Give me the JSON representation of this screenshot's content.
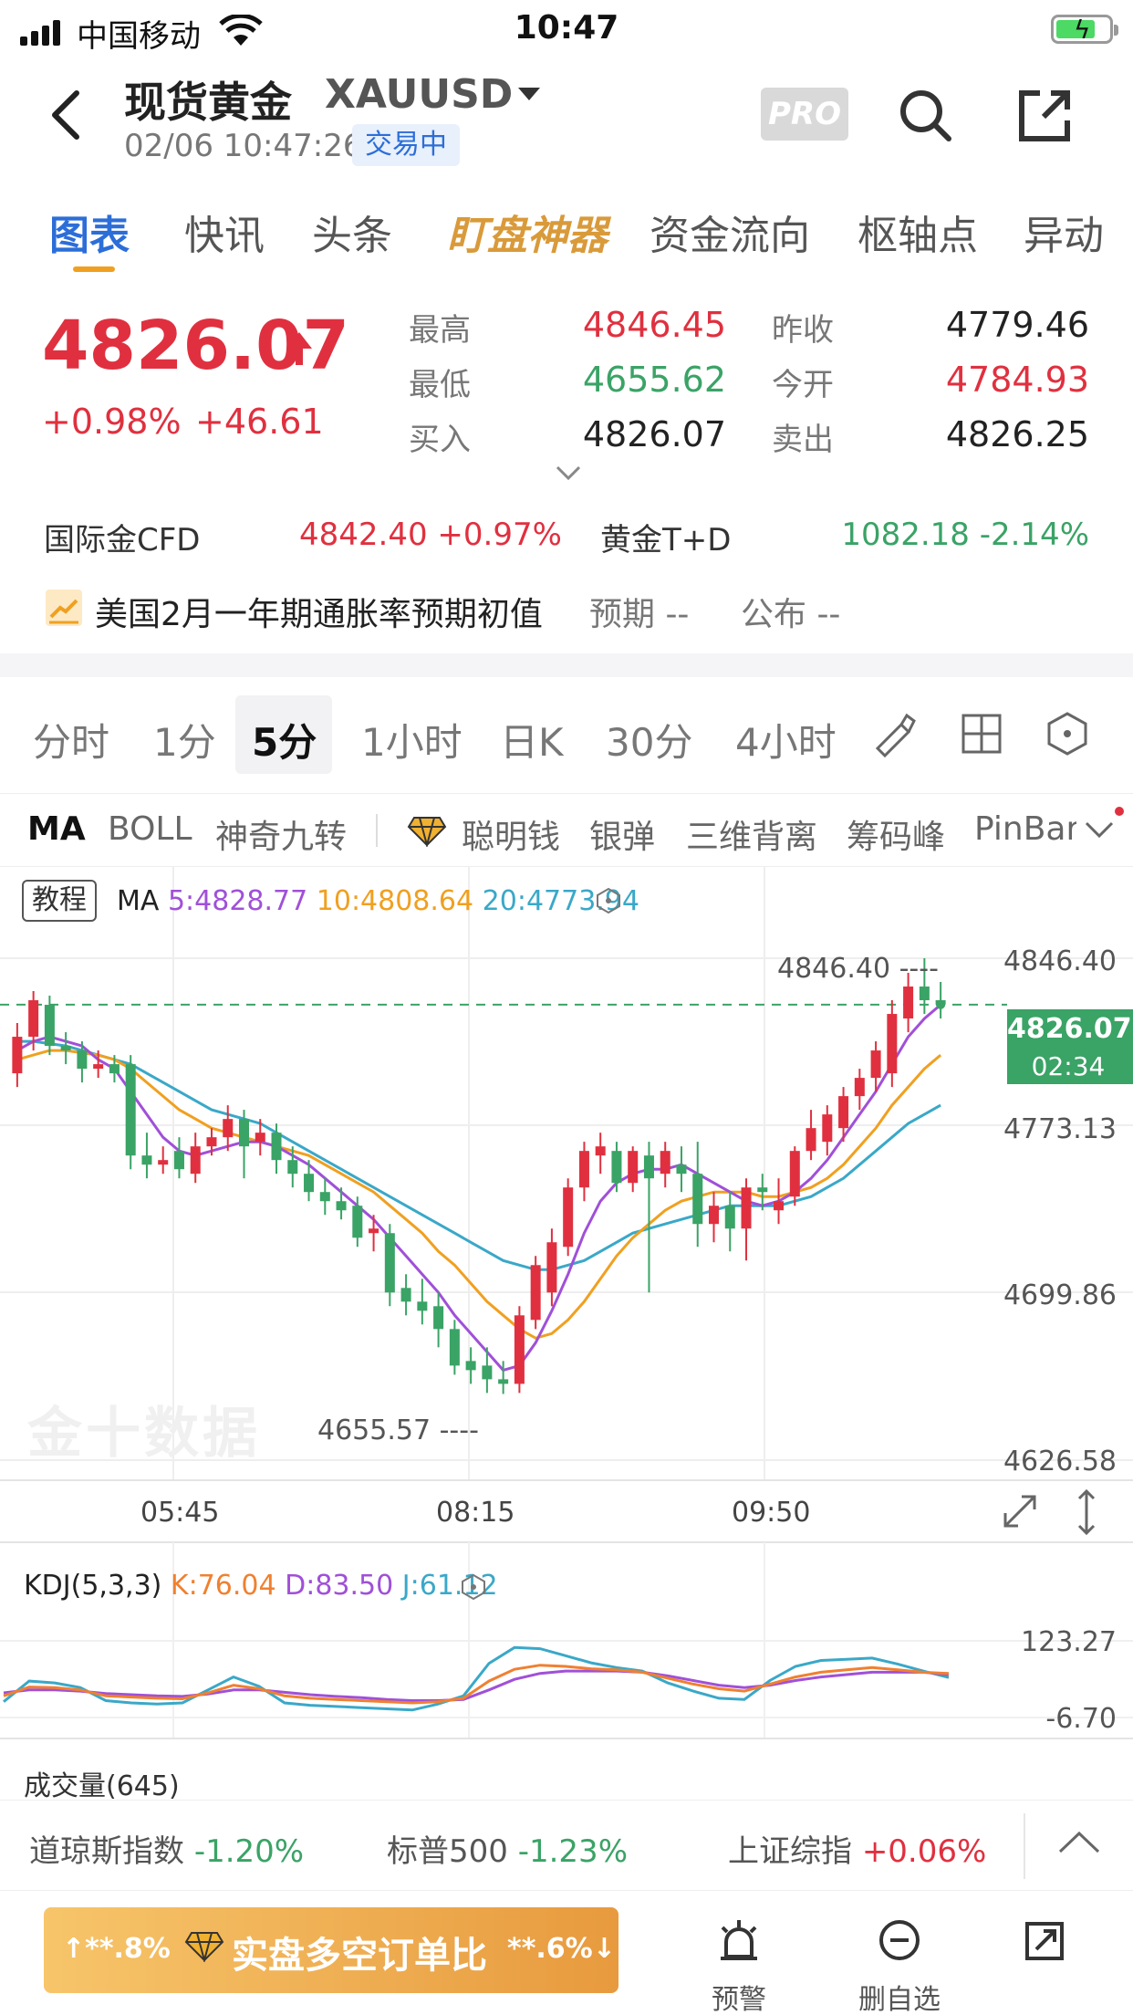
{
  "status": {
    "carrier": "中国移动",
    "time": "10:47"
  },
  "header": {
    "title": "现货黄金",
    "symbol": "XAUUSD",
    "datetime": "02/06 10:47:26",
    "state": "交易中",
    "pro": "PRO"
  },
  "tabs": [
    {
      "label": "图表"
    },
    {
      "label": "快讯"
    },
    {
      "label": "头条"
    },
    {
      "label": "盯盘神器"
    },
    {
      "label": "资金流向"
    },
    {
      "label": "枢轴点"
    },
    {
      "label": "异动"
    }
  ],
  "quote": {
    "price": "4826.07",
    "pct": "+0.98%",
    "change": "+46.61",
    "high_label": "最高",
    "high": "4846.45",
    "low_label": "最低",
    "low": "4655.62",
    "bid_label": "买入",
    "bid": "4826.07",
    "prev_label": "昨收",
    "prev": "4779.46",
    "open_label": "今开",
    "open": "4784.93",
    "ask_label": "卖出",
    "ask": "4826.25"
  },
  "related": {
    "cfd_label": "国际金CFD",
    "cfd_value": "4842.40  +0.97%",
    "td_label": "黄金T+D",
    "td_value": "1082.18  -2.14%"
  },
  "news": {
    "text": "美国2月一年期通胀率预期初值",
    "expected": "预期 --",
    "published": "公布 --"
  },
  "periods": [
    {
      "label": "分时"
    },
    {
      "label": "1分"
    },
    {
      "label": "5分"
    },
    {
      "label": "1小时"
    },
    {
      "label": "日K"
    },
    {
      "label": "30分"
    },
    {
      "label": "4小时"
    }
  ],
  "indicators": [
    {
      "label": "MA"
    },
    {
      "label": "BOLL"
    },
    {
      "label": "神奇九转"
    },
    {
      "label": "聪明钱"
    },
    {
      "label": "银弹"
    },
    {
      "label": "三维背离"
    },
    {
      "label": "筹码峰"
    },
    {
      "label": "PinBar"
    }
  ],
  "chart": {
    "tutorial": "教程",
    "ma_label": "MA",
    "ma5": "5:4828.77",
    "ma10": "10:4808.64",
    "ma20": "20:4773.94",
    "y_labels": [
      "4846.40",
      "4773.13",
      "4699.86",
      "4626.58"
    ],
    "high_marker": "4846.40 ----",
    "low_marker": "4655.57 ----",
    "current_price": "4826.07",
    "countdown": "02:34",
    "time_labels": [
      "05:45",
      "08:15",
      "09:50"
    ],
    "watermark": "金十数据",
    "colors": {
      "up": "#e0303f",
      "down": "#3aa366",
      "ma5": "#a050d8",
      "ma10": "#f0a020",
      "ma20": "#3aa8c8"
    }
  },
  "chart_data": {
    "type": "candlestick",
    "ylim": [
      4626.58,
      4846.4
    ],
    "candles": [
      {
        "o": 4796,
        "c": 4812,
        "h": 4818,
        "l": 4790
      },
      {
        "o": 4812,
        "c": 4828,
        "h": 4832,
        "l": 4806
      },
      {
        "o": 4826,
        "c": 4808,
        "h": 4830,
        "l": 4804
      },
      {
        "o": 4808,
        "c": 4806,
        "h": 4814,
        "l": 4800
      },
      {
        "o": 4806,
        "c": 4798,
        "h": 4810,
        "l": 4792
      },
      {
        "o": 4798,
        "c": 4800,
        "h": 4806,
        "l": 4794
      },
      {
        "o": 4800,
        "c": 4796,
        "h": 4804,
        "l": 4792
      },
      {
        "o": 4800,
        "c": 4760,
        "h": 4804,
        "l": 4754
      },
      {
        "o": 4760,
        "c": 4756,
        "h": 4770,
        "l": 4750
      },
      {
        "o": 4756,
        "c": 4758,
        "h": 4764,
        "l": 4752
      },
      {
        "o": 4762,
        "c": 4754,
        "h": 4768,
        "l": 4750
      },
      {
        "o": 4752,
        "c": 4764,
        "h": 4770,
        "l": 4748
      },
      {
        "o": 4764,
        "c": 4768,
        "h": 4772,
        "l": 4760
      },
      {
        "o": 4768,
        "c": 4776,
        "h": 4782,
        "l": 4762
      },
      {
        "o": 4776,
        "c": 4764,
        "h": 4780,
        "l": 4750
      },
      {
        "o": 4766,
        "c": 4770,
        "h": 4776,
        "l": 4760
      },
      {
        "o": 4770,
        "c": 4758,
        "h": 4774,
        "l": 4752
      },
      {
        "o": 4758,
        "c": 4752,
        "h": 4764,
        "l": 4746
      },
      {
        "o": 4752,
        "c": 4744,
        "h": 4758,
        "l": 4740
      },
      {
        "o": 4744,
        "c": 4740,
        "h": 4750,
        "l": 4734
      },
      {
        "o": 4740,
        "c": 4736,
        "h": 4746,
        "l": 4732
      },
      {
        "o": 4738,
        "c": 4724,
        "h": 4742,
        "l": 4720
      },
      {
        "o": 4726,
        "c": 4728,
        "h": 4734,
        "l": 4718
      },
      {
        "o": 4726,
        "c": 4700,
        "h": 4730,
        "l": 4694
      },
      {
        "o": 4702,
        "c": 4696,
        "h": 4708,
        "l": 4690
      },
      {
        "o": 4696,
        "c": 4692,
        "h": 4706,
        "l": 4686
      },
      {
        "o": 4694,
        "c": 4684,
        "h": 4700,
        "l": 4676
      },
      {
        "o": 4684,
        "c": 4668,
        "h": 4688,
        "l": 4664
      },
      {
        "o": 4670,
        "c": 4666,
        "h": 4676,
        "l": 4660
      },
      {
        "o": 4668,
        "c": 4662,
        "h": 4676,
        "l": 4656
      },
      {
        "o": 4662,
        "c": 4660,
        "h": 4670,
        "l": 4655.57
      },
      {
        "o": 4660,
        "c": 4690,
        "h": 4694,
        "l": 4656
      },
      {
        "o": 4688,
        "c": 4712,
        "h": 4716,
        "l": 4684
      },
      {
        "o": 4700,
        "c": 4722,
        "h": 4728,
        "l": 4694
      },
      {
        "o": 4720,
        "c": 4746,
        "h": 4750,
        "l": 4716
      },
      {
        "o": 4746,
        "c": 4762,
        "h": 4766,
        "l": 4740
      },
      {
        "o": 4760,
        "c": 4764,
        "h": 4770,
        "l": 4752
      },
      {
        "o": 4762,
        "c": 4748,
        "h": 4766,
        "l": 4744
      },
      {
        "o": 4748,
        "c": 4762,
        "h": 4764,
        "l": 4744
      },
      {
        "o": 4760,
        "c": 4750,
        "h": 4766,
        "l": 4700
      },
      {
        "o": 4752,
        "c": 4762,
        "h": 4766,
        "l": 4746
      },
      {
        "o": 4756,
        "c": 4752,
        "h": 4764,
        "l": 4744
      },
      {
        "o": 4752,
        "c": 4730,
        "h": 4766,
        "l": 4720
      },
      {
        "o": 4730,
        "c": 4738,
        "h": 4744,
        "l": 4722
      },
      {
        "o": 4738,
        "c": 4728,
        "h": 4744,
        "l": 4718
      },
      {
        "o": 4728,
        "c": 4746,
        "h": 4750,
        "l": 4714
      },
      {
        "o": 4746,
        "c": 4744,
        "h": 4752,
        "l": 4736
      },
      {
        "o": 4736,
        "c": 4740,
        "h": 4750,
        "l": 4730
      },
      {
        "o": 4742,
        "c": 4762,
        "h": 4764,
        "l": 4738
      },
      {
        "o": 4762,
        "c": 4772,
        "h": 4780,
        "l": 4758
      },
      {
        "o": 4766,
        "c": 4778,
        "h": 4782,
        "l": 4760
      },
      {
        "o": 4772,
        "c": 4786,
        "h": 4790,
        "l": 4766
      },
      {
        "o": 4786,
        "c": 4794,
        "h": 4798,
        "l": 4780
      },
      {
        "o": 4794,
        "c": 4806,
        "h": 4810,
        "l": 4788
      },
      {
        "o": 4796,
        "c": 4822,
        "h": 4828,
        "l": 4790
      },
      {
        "o": 4820,
        "c": 4834,
        "h": 4840,
        "l": 4814
      },
      {
        "o": 4834,
        "c": 4828,
        "h": 4846.4,
        "l": 4822
      },
      {
        "o": 4828,
        "c": 4826.07,
        "h": 4836,
        "l": 4820
      }
    ],
    "ma5": [
      4806,
      4810,
      4812,
      4810,
      4808,
      4802,
      4798,
      4788,
      4778,
      4768,
      4762,
      4760,
      4762,
      4764,
      4766,
      4766,
      4764,
      4760,
      4756,
      4750,
      4744,
      4738,
      4732,
      4724,
      4716,
      4708,
      4700,
      4690,
      4682,
      4674,
      4666,
      4668,
      4678,
      4692,
      4708,
      4726,
      4740,
      4748,
      4752,
      4754,
      4754,
      4756,
      4752,
      4748,
      4744,
      4740,
      4738,
      4740,
      4744,
      4750,
      4758,
      4768,
      4778,
      4788,
      4800,
      4812,
      4820,
      4826
    ],
    "ma10": [
      4802,
      4804,
      4806,
      4806,
      4805,
      4804,
      4802,
      4798,
      4792,
      4786,
      4780,
      4776,
      4772,
      4770,
      4768,
      4766,
      4764,
      4762,
      4760,
      4756,
      4752,
      4748,
      4744,
      4738,
      4732,
      4726,
      4718,
      4712,
      4704,
      4696,
      4690,
      4684,
      4680,
      4682,
      4688,
      4696,
      4706,
      4716,
      4724,
      4730,
      4736,
      4740,
      4742,
      4744,
      4744,
      4744,
      4742,
      4742,
      4744,
      4746,
      4750,
      4756,
      4764,
      4772,
      4782,
      4790,
      4798,
      4804
    ],
    "ma20": [
      4810,
      4810,
      4809,
      4808,
      4806,
      4804,
      4802,
      4800,
      4796,
      4792,
      4788,
      4784,
      4780,
      4778,
      4776,
      4774,
      4770,
      4766,
      4762,
      4758,
      4754,
      4750,
      4746,
      4742,
      4738,
      4734,
      4730,
      4726,
      4722,
      4718,
      4714,
      4712,
      4710,
      4710,
      4712,
      4714,
      4718,
      4722,
      4726,
      4728,
      4730,
      4732,
      4734,
      4736,
      4738,
      4738,
      4738,
      4738,
      4740,
      4742,
      4746,
      4750,
      4756,
      4762,
      4768,
      4774,
      4778,
      4782
    ],
    "kdj": {
      "ylim": [
        -6.7,
        123.27
      ],
      "k": [
        30,
        45,
        44,
        40,
        30,
        28,
        26,
        25,
        35,
        48,
        42,
        30,
        26,
        24,
        22,
        20,
        18,
        20,
        26,
        55,
        75,
        82,
        80,
        76,
        74,
        70,
        60,
        50,
        42,
        38,
        50,
        62,
        70,
        74,
        78,
        74,
        70,
        68
      ],
      "d": [
        35,
        40,
        40,
        38,
        34,
        32,
        30,
        29,
        33,
        40,
        40,
        36,
        32,
        29,
        27,
        24,
        22,
        22,
        24,
        40,
        58,
        68,
        72,
        72,
        72,
        70,
        64,
        56,
        48,
        44,
        48,
        56,
        62,
        66,
        70,
        70,
        70,
        66
      ],
      "j": [
        20,
        55,
        52,
        44,
        22,
        18,
        16,
        18,
        40,
        62,
        46,
        18,
        14,
        12,
        10,
        8,
        6,
        16,
        30,
        85,
        112,
        110,
        98,
        86,
        78,
        72,
        52,
        38,
        26,
        24,
        56,
        80,
        90,
        92,
        94,
        84,
        72,
        61
      ]
    }
  },
  "kdj_info": {
    "label": "KDJ(5,3,3)",
    "k": "K:76.04",
    "d": "D:83.50",
    "j": "J:61.12",
    "y_top": "123.27",
    "y_bottom": "-6.70"
  },
  "volume": {
    "label": "成交量(645)"
  },
  "indices": [
    {
      "name": "道琼斯指数",
      "value": "-1.20%"
    },
    {
      "name": "标普500",
      "value": "-1.23%"
    },
    {
      "name": "上证综指",
      "value": "+0.06%"
    }
  ],
  "bottom": {
    "long_pct": "**.8%",
    "title": "实盘多空订单比",
    "short_pct": "**.6%",
    "alert": "预警",
    "remove": "删自选",
    "share": ""
  }
}
